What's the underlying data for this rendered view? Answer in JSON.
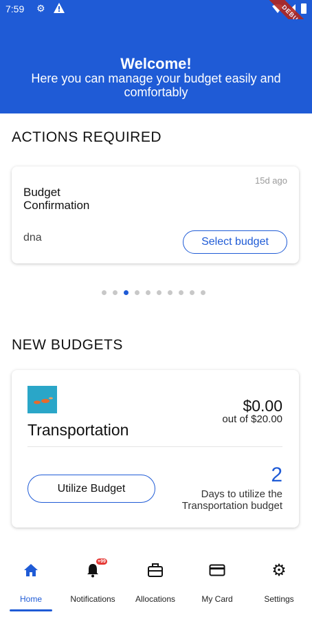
{
  "status_bar": {
    "time": "7:59"
  },
  "debug_banner": "DEBUG",
  "header": {
    "title": "Welcome!",
    "subtitle": "Here you can manage your budget easily and comfortably"
  },
  "actions_section": {
    "title": "ACTIONS REQUIRED",
    "card": {
      "time_ago": "15d ago",
      "name": "Budget Confirmation",
      "detail": "dna",
      "button_label": "Select budget"
    },
    "pager": {
      "count": 10,
      "active_index": 2
    }
  },
  "budgets_section": {
    "title": "NEW BUDGETS",
    "card": {
      "name": "Transportation",
      "spent": "$0.00",
      "total": "out of $20.00",
      "button_label": "Utilize Budget",
      "days_count": "2",
      "days_text": "Days to utilize the Transportation budget"
    }
  },
  "nav": {
    "items": [
      {
        "label": "Home",
        "icon": "home-icon"
      },
      {
        "label": "Notifications",
        "icon": "bell-icon",
        "badge": "+99"
      },
      {
        "label": "Allocations",
        "icon": "briefcase-icon"
      },
      {
        "label": "My Card",
        "icon": "credit-card-icon"
      },
      {
        "label": "Settings",
        "icon": "gear-icon"
      }
    ],
    "active_index": 0
  },
  "colors": {
    "primary": "#1f5bd6",
    "badge": "#e53935",
    "ribbon": "#b3261e"
  }
}
